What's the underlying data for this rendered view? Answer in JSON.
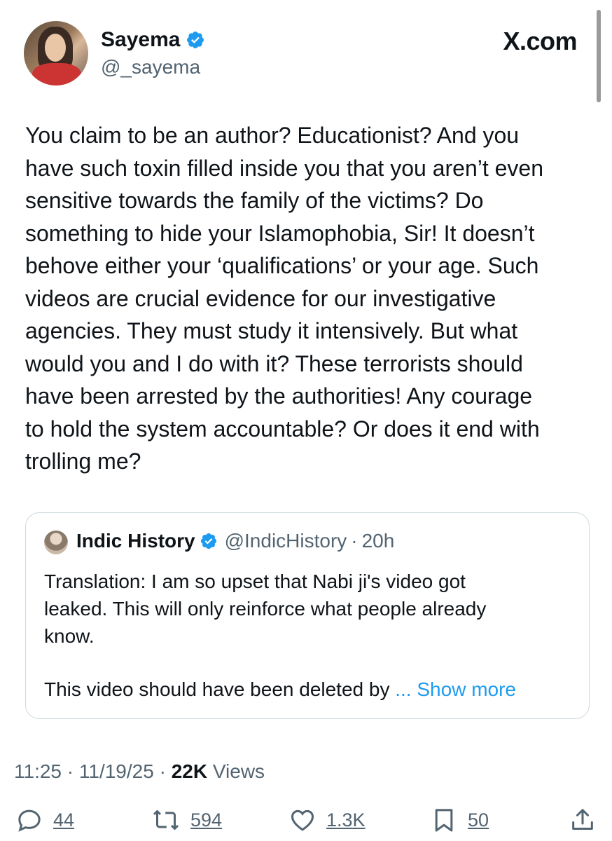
{
  "brand": {
    "label": "X.com"
  },
  "author": {
    "name": "Sayema",
    "handle": "@_sayema"
  },
  "tweet": {
    "text": "You claim to be an author? Educationist? And you\nhave such toxin filled inside you that you aren’t even\nsensitive towards the family of the victims? Do\nsomething to hide your Islamophobia, Sir! It doesn’t\nbehove either your ‘qualifications’ or your age. Such\nvideos are crucial evidence for our investigative\nagencies. They must study it intensively. But what\nwould you and I do with it? These terrorists should\nhave been arrested by the authorities! Any courage\nto hold the system accountable? Or does it end with\ntrolling me?"
  },
  "quote": {
    "name": "Indic History",
    "handle": "@IndicHistory",
    "separator": "·",
    "time": "20h",
    "text": "Translation: I am so upset that Nabi ji's video got\nleaked. This will only reinforce what people already\nknow.",
    "tail": "This video should have been deleted by ",
    "show_more": "... Show more"
  },
  "meta": {
    "time": "11:25",
    "sep": "·",
    "date": "11/19/25",
    "views_count": "22K",
    "views_label": "Views"
  },
  "actions": {
    "replies": "44",
    "reposts": "594",
    "likes": "1.3K",
    "bookmarks": "50"
  },
  "colors": {
    "accent": "#1d9bf0",
    "muted": "#536471",
    "border": "#cfd9de"
  },
  "icons": [
    "verified-badge-icon",
    "reply-icon",
    "repost-icon",
    "like-icon",
    "bookmark-icon",
    "share-icon"
  ]
}
